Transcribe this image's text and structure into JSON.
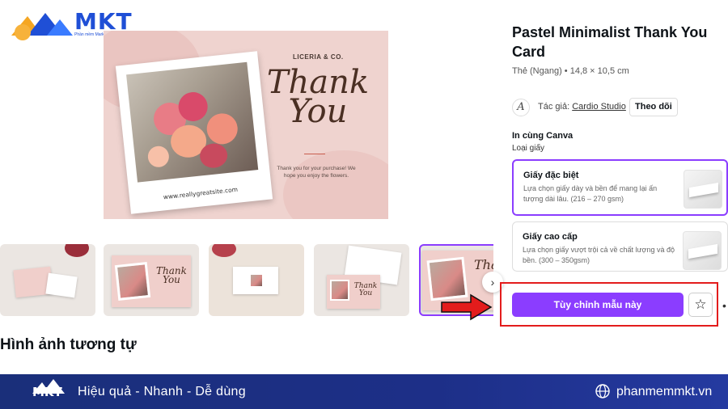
{
  "brand": {
    "logo_text": "MKT",
    "logo_subtitle": "Phần mềm Marketing Đa năng",
    "colors": {
      "primary": "#1f4fd6",
      "accent_orange": "#f5a623",
      "purple": "#8b3dff",
      "highlight": "#e31c1c",
      "footer": "#1d2f88"
    }
  },
  "preview": {
    "card_brand": "LICERIA & CO.",
    "card_heading": "Thank You",
    "card_message": "Thank you for your purchase! We hope you enjoy the flowers.",
    "card_url": "www.reallygreatsite.com"
  },
  "thumbnails": [
    {
      "text": ""
    },
    {
      "text": "Thank You"
    },
    {
      "text": ""
    },
    {
      "text": "Thank You"
    },
    {
      "text": "Tha"
    }
  ],
  "next_icon": "chevron-right-icon",
  "similar_heading": "Hình ảnh tương tự",
  "product": {
    "title": "Pastel Minimalist Thank You Card",
    "dimensions": "Thẻ (Ngang) • 14,8 × 10,5 cm",
    "author_label": "Tác giả:",
    "author_name": "Cardio Studio",
    "author_avatar": "A",
    "follow_label": "Theo dõi",
    "print_heading": "In cùng Canva",
    "paper_type_label": "Loại giấy",
    "options": [
      {
        "title": "Giấy đặc biệt",
        "desc": "Lựa chọn giấy dày và bền để mang lại ấn tượng dài lâu. (216 – 270 gsm)",
        "selected": true
      },
      {
        "title": "Giấy cao cấp",
        "desc": "Lựa chọn giấy vượt trội cả về chất lượng và độ bền. (300 – 350gsm)",
        "selected": false
      }
    ],
    "customize_label": "Tùy chỉnh mẫu này",
    "star_icon": "star-icon",
    "more_icon": "more-icon"
  },
  "footer": {
    "logo_text": "MKT",
    "tagline": "Hiệu quả - Nhanh - Dễ dùng",
    "site": "phanmemmkt.vn"
  }
}
